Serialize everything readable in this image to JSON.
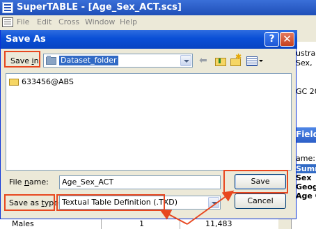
{
  "app": {
    "title": "SuperTABLE - [Age_Sex_ACT.scs]",
    "menu": [
      "File",
      "Edit",
      "Cross",
      "Window",
      "Help"
    ]
  },
  "background": {
    "right_pane_lines": [
      "ustra",
      "Sex,",
      "",
      "GC 20"
    ],
    "fields_panel": {
      "header": "Field",
      "column_label": "ame:",
      "items": [
        "Summ",
        "Sex",
        "Geog",
        "Age C"
      ],
      "selected_index": 0
    },
    "table_row": {
      "label": "Males",
      "count": "1",
      "value": "11,483"
    }
  },
  "dialog": {
    "title": "Save As",
    "help_label": "?",
    "close_label": "✕",
    "save_in": {
      "label_prefix": "Save ",
      "label_key": "i",
      "label_suffix": "n:",
      "value": "Dataset_folder"
    },
    "files": [
      "633456@ABS"
    ],
    "file_name": {
      "label_prefix": "File ",
      "label_key": "n",
      "label_suffix": "ame:",
      "value": "Age_Sex_ACT"
    },
    "save_as_type": {
      "label_prefix": "Save as ",
      "label_key": "t",
      "label_suffix": "ype:",
      "value": "Textual Table Definition (.TXD)"
    },
    "save_button": "Save",
    "cancel_button": "Cancel"
  },
  "colors": {
    "highlight": "#e8471f",
    "title_blue": "#0a4fd6",
    "selection": "#316ac5"
  }
}
